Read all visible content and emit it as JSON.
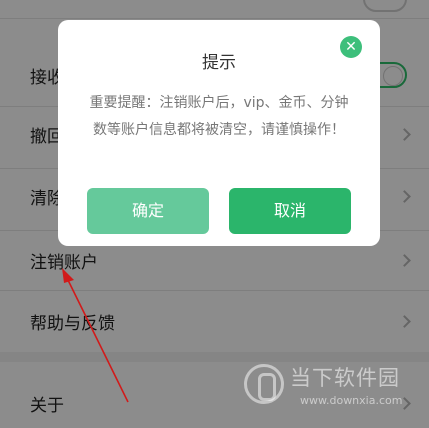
{
  "settings": {
    "rows": [
      {
        "label": "接收",
        "type": "toggle"
      },
      {
        "label": "撤回",
        "type": "chevron"
      },
      {
        "label": "清除",
        "type": "chevron"
      },
      {
        "label": "注销账户",
        "type": "chevron"
      },
      {
        "label": "帮助与反馈",
        "type": "chevron"
      },
      {
        "label": "关于",
        "type": "chevron"
      }
    ]
  },
  "dialog": {
    "title": "提示",
    "close_symbol": "✕",
    "message": "重要提醒：注销账户后，vip、金币、分钟数等账户信息都将被清空，请谨慎操作！",
    "confirm_label": "确定",
    "cancel_label": "取消"
  },
  "watermark": {
    "name": "当下软件园",
    "url": "www.downxia.com"
  },
  "colors": {
    "accent": "#2bb56b",
    "confirm_button": "#65c99b",
    "close_icon": "#3dbf7b",
    "arrow": "#d11a1a"
  }
}
